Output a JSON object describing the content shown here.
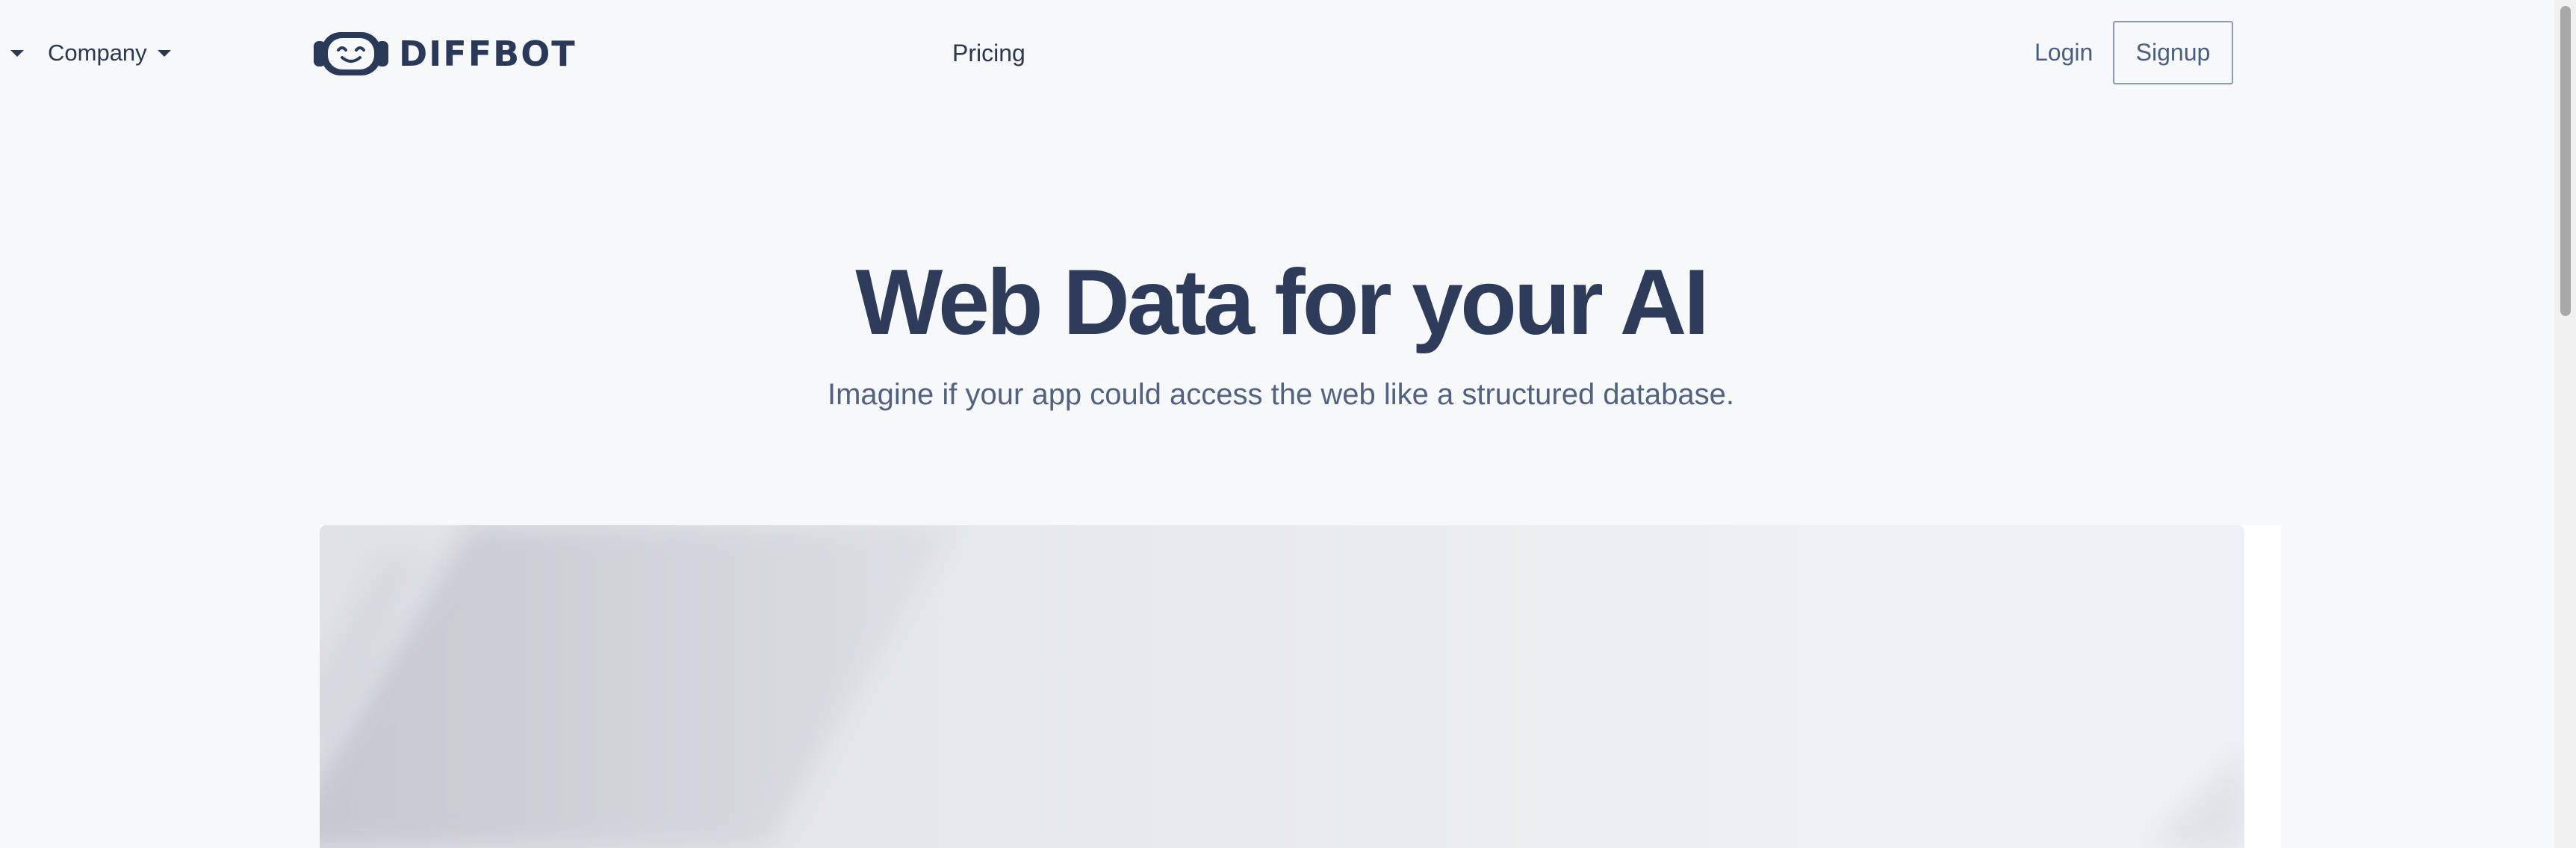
{
  "nav": {
    "company_label": "Company",
    "logo_text": "DIFFBOT",
    "pricing_label": "Pricing",
    "login_label": "Login",
    "signup_label": "Signup"
  },
  "hero": {
    "title": "Web Data for your AI",
    "subtitle": "Imagine if your app could access the web like a structured database."
  },
  "icons": {
    "nav_caret": "chevron-down-icon",
    "logo": "robot-face-icon"
  },
  "colors": {
    "brand_navy": "#2a3957",
    "background": "#f7f8fa",
    "text_muted": "#52627e"
  }
}
